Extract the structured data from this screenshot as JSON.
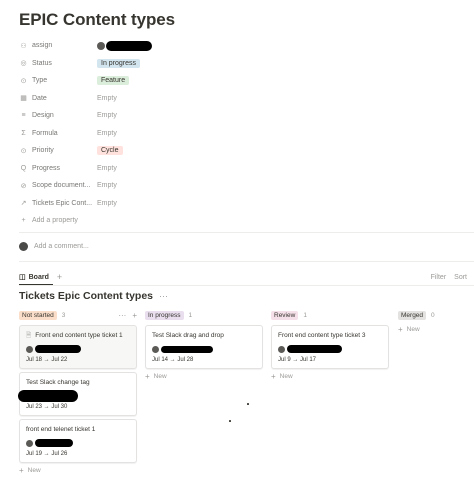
{
  "page": {
    "title": "EPIC Content types"
  },
  "properties": [
    {
      "name": "assign",
      "icon": "people-icon",
      "glyph": "⚇",
      "value": "",
      "kind": "person"
    },
    {
      "name": "Status",
      "icon": "status-icon",
      "glyph": "◎",
      "value": "In progress",
      "kind": "tag",
      "color": "#d3e5ef"
    },
    {
      "name": "Type",
      "icon": "select-icon",
      "glyph": "⊙",
      "value": "Feature",
      "kind": "tag",
      "color": "#dbeddb"
    },
    {
      "name": "Date",
      "icon": "calendar-icon",
      "glyph": "▦",
      "value": "Empty",
      "kind": "empty"
    },
    {
      "name": "Design",
      "icon": "text-icon",
      "glyph": "≡",
      "value": "Empty",
      "kind": "empty"
    },
    {
      "name": "Formula",
      "icon": "formula-icon",
      "glyph": "Σ",
      "value": "Empty",
      "kind": "empty"
    },
    {
      "name": "Priority",
      "icon": "select-icon",
      "glyph": "⊙",
      "value": "Cycle",
      "kind": "tag",
      "color": "#ffe2dd"
    },
    {
      "name": "Progress",
      "icon": "rollup-icon",
      "glyph": "Q",
      "value": "Empty",
      "kind": "empty"
    },
    {
      "name": "Scope document...",
      "icon": "link-icon",
      "glyph": "⊘",
      "value": "Empty",
      "kind": "empty"
    },
    {
      "name": "Tickets Epic Cont...",
      "icon": "relation-icon",
      "glyph": "↗",
      "value": "Empty",
      "kind": "empty"
    }
  ],
  "add_property": {
    "icon_glyph": "+",
    "label": "Add a property"
  },
  "comment": {
    "placeholder": "Add a comment..."
  },
  "view": {
    "tab_label": "Board",
    "tab_glyph": "◫",
    "add_glyph": "+",
    "filter_label": "Filter",
    "sort_label": "Sort"
  },
  "board": {
    "title": "Tickets Epic Content types",
    "more_glyph": "···",
    "new_label": "New",
    "columns": [
      {
        "name": "Not started",
        "count": "3",
        "color": "#fadec9",
        "cards": [
          {
            "title": "Front end content type ticket 1",
            "date": "Jul 18 → Jul 22",
            "has_doc_icon": true
          },
          {
            "title": "Test Slack change tag",
            "date": "Jul 23 → Jul 30",
            "has_doc_icon": false
          },
          {
            "title": "front end telenet ticket 1",
            "date": "Jul 19 → Jul 26",
            "has_doc_icon": false
          }
        ]
      },
      {
        "name": "In progress",
        "count": "1",
        "color": "#e8deee",
        "cards": [
          {
            "title": "Test Slack drag and drop",
            "date": "Jul 14 → Jul 28",
            "has_doc_icon": false
          }
        ]
      },
      {
        "name": "Review",
        "count": "1",
        "color": "#f5e0e9",
        "cards": [
          {
            "title": "Front end content type ticket 3",
            "date": "Jul 9 → Jul 17",
            "has_doc_icon": false
          }
        ]
      },
      {
        "name": "Merged",
        "count": "0",
        "color": "#e3e2e0",
        "cards": []
      }
    ]
  }
}
